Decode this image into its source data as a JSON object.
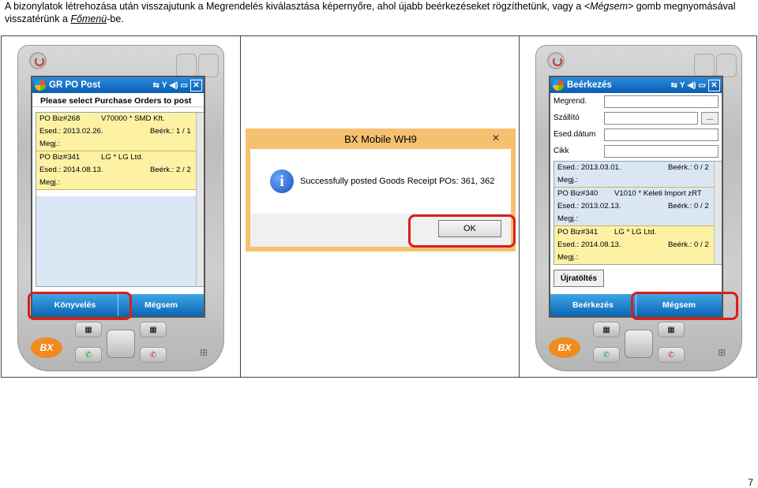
{
  "caption": {
    "part1": "A bizonylatok létrehozása után visszajutunk a Megrendelés kiválasztása képernyőre, ahol újabb beérkezéseket rögzíthetünk, vagy a ",
    "megsem": "<Mégsem>",
    "part2": " gomb megnyomásával visszatérünk a ",
    "fomenu": "Főmenü",
    "part3": "-be."
  },
  "page_number": "7",
  "left_device": {
    "title": "GR PO Post",
    "subtitle": "Please select Purchase Orders to post",
    "orders": [
      {
        "po": "PO Biz#268",
        "vendor": "V70000 * SMD Kft.",
        "esed": "Esed.: 2013.02.26.",
        "beerk": "Beérk.: 1 / 1",
        "megj": "Megj.:"
      },
      {
        "po": "PO Biz#341",
        "vendor": "LG * LG Ltd.",
        "esed": "Esed.: 2014.08.13.",
        "beerk": "Beérk.: 2 / 2",
        "megj": "Megj.:"
      }
    ],
    "soft_left": "Könyvelés",
    "soft_right": "Mégsem"
  },
  "dialog": {
    "title": "BX Mobile WH9",
    "message": "Successfully posted Goods Receipt POs: 361, 362",
    "ok": "OK",
    "close": "✕"
  },
  "right_device": {
    "title": "Beérkezés",
    "fields": {
      "megrend": "Megrend.",
      "szallito": "Szállító",
      "eseddatum": "Esed.dátum",
      "cikk": "Cikk"
    },
    "dots": "...",
    "orders": [
      {
        "po": "",
        "vendor": "",
        "esed": "Esed.: 2013.03.01.",
        "beerk": "Beérk.: 0 / 2",
        "megj": "Megj.:"
      },
      {
        "po": "PO Biz#340",
        "vendor": "V1010 * Keleti Import zRT",
        "esed": "Esed.: 2013.02.13.",
        "beerk": "Beérk.: 0 / 2",
        "megj": "Megj.:"
      },
      {
        "po": "PO Biz#341",
        "vendor": "LG * LG Ltd.",
        "esed": "Esed.: 2014.08.13.",
        "beerk": "Beérk.: 0 / 2",
        "megj": "Megj.:"
      }
    ],
    "reload": "Újratöltés",
    "soft_left": "Beérkezés",
    "soft_right": "Mégsem"
  },
  "brand": "BX",
  "colors": {
    "highlight": "#d81e1e",
    "softbar": "#0b66b5",
    "row": "#fdf1a4",
    "dialog_frame": "#f5c170"
  }
}
